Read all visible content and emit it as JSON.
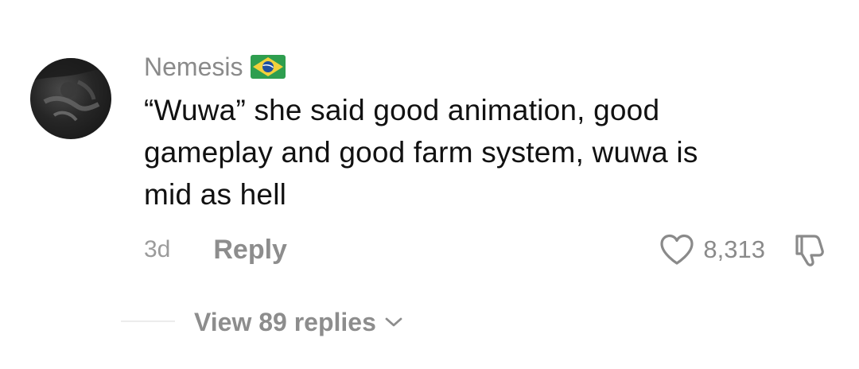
{
  "comment": {
    "username": "Nemesis",
    "flag_icon": "brazil-flag-icon",
    "text_lines": [
      "“Wuwa” she said good animation, good",
      "gameplay and good farm system, wuwa is",
      "mid as hell"
    ],
    "time": "3d",
    "reply_label": "Reply",
    "like_count": "8,313",
    "like_icon": "heart-outline-icon",
    "dislike_icon": "thumbs-down-icon"
  },
  "replies": {
    "view_label": "View 89 replies",
    "chevron_icon": "chevron-down-icon"
  },
  "colors": {
    "muted_text": "#8a8a8a",
    "body_text": "#111111",
    "flag_green": "#2e9e4f",
    "flag_yellow": "#f2d03b",
    "flag_blue": "#1f4fa0"
  }
}
